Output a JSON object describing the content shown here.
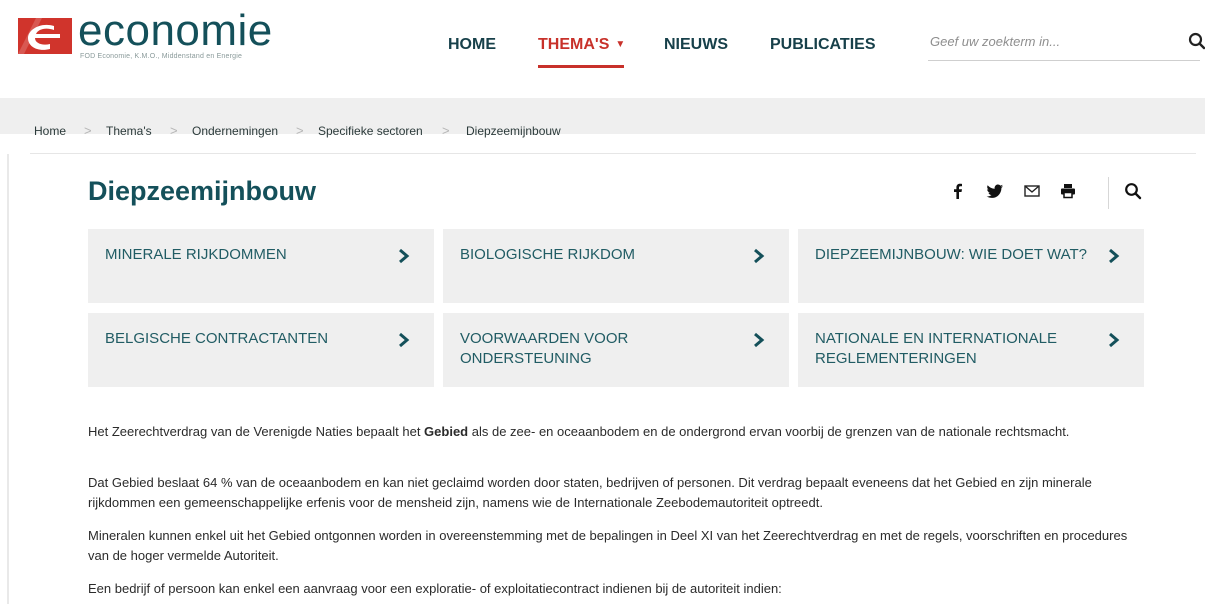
{
  "header": {
    "logo_text": "economie",
    "logo_subtitle": "FOD Economie, K.M.O., Middenstand en Energie",
    "nav": [
      {
        "label": "HOME"
      },
      {
        "label": "THEMA'S"
      },
      {
        "label": "NIEUWS"
      },
      {
        "label": "PUBLICATIES"
      }
    ],
    "search": {
      "placeholder": "Geef uw zoekterm in...",
      "value": ""
    }
  },
  "breadcrumb": [
    "Home",
    "Thema's",
    "Ondernemingen",
    "Specifieke sectoren",
    "Diepzeemijnbouw"
  ],
  "page": {
    "title": "Diepzeemijnbouw",
    "share_icons": [
      "facebook-icon",
      "twitter-icon",
      "mail-icon",
      "print-icon",
      "search-icon"
    ],
    "tiles": [
      {
        "label": "MINERALE RIJKDOMMEN"
      },
      {
        "label": "BIOLOGISCHE RIJKDOM"
      },
      {
        "label": "DIEPZEEMIJNBOUW: WIE DOET WAT?"
      },
      {
        "label": "BELGISCHE CONTRACTANTEN"
      },
      {
        "label": "VOORWAARDEN VOOR ONDERSTEUNING"
      },
      {
        "label": "NATIONALE EN INTERNATIONALE REGLEMENTERINGEN"
      }
    ],
    "paragraphs": [
      {
        "before": "Het Zeerechtverdrag van de Verenigde Naties bepaalt het ",
        "bold": "Gebied",
        "after": " als de zee- en oceaanbodem en de ondergrond ervan voorbij de grenzen van de nationale rechtsmacht."
      },
      {
        "text": "Dat Gebied beslaat 64 % van de oceaanbodem en kan niet geclaimd worden door staten, bedrijven of personen. Dit verdrag bepaalt eveneens dat het Gebied en zijn minerale rijkdommen een gemeenschappelijke erfenis voor de mensheid zijn, namens wie de Internationale Zeebodemautoriteit optreedt."
      },
      {
        "text": "Mineralen kunnen enkel uit het Gebied ontgonnen worden in overeenstemming met de bepalingen in Deel XI van het Zeerechtverdrag en met de regels, voorschriften en procedures van de hoger vermelde Autoriteit."
      },
      {
        "text": "Een bedrijf of persoon kan enkel een aanvraag voor een exploratie- of exploitatiecontract indienen bij de autoriteit indien:"
      }
    ]
  },
  "colors": {
    "brand_red": "#c8312a",
    "brand_teal": "#14505a",
    "tile_bg": "#efefef"
  }
}
